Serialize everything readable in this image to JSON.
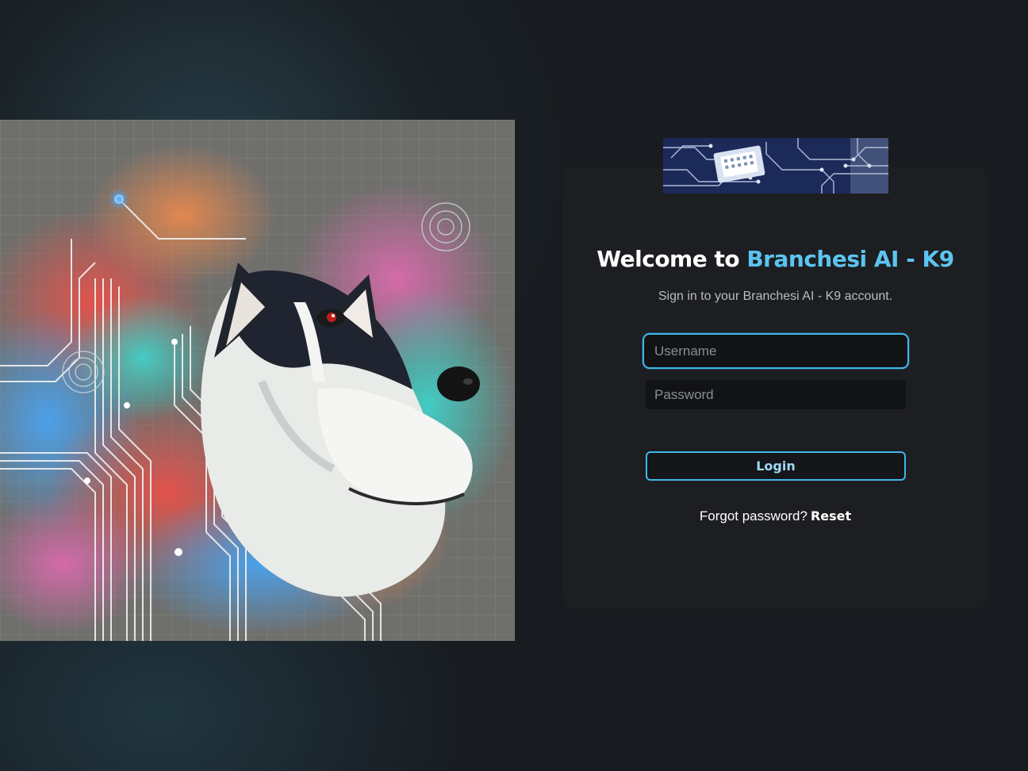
{
  "hero": {
    "image": "husky-circuit-artwork",
    "palette": {
      "background": "#6f6f6c",
      "circuit": "#f2f2f2",
      "blue": "#3d8fe0",
      "red": "#e04a44",
      "teal": "#3fc9c4"
    }
  },
  "banner": {
    "image": "circuit-board-banner",
    "base_color": "#1c2a5a",
    "trace_color": "#c9d6f0"
  },
  "login": {
    "title_prefix": "Welcome to",
    "title_accent": "Branchesi AI - K9",
    "subtitle": "Sign in to your Branchesi AI - K9 account.",
    "username_placeholder": "Username",
    "username_value": "",
    "password_placeholder": "Password",
    "password_value": "",
    "login_label": "Login",
    "forgot_text": "Forgot password?",
    "reset_label": "Reset"
  },
  "colors": {
    "accent": "#5cc4f0",
    "focus_border": "#3fb6ea",
    "card": "#1d1e21",
    "field": "#121315"
  }
}
